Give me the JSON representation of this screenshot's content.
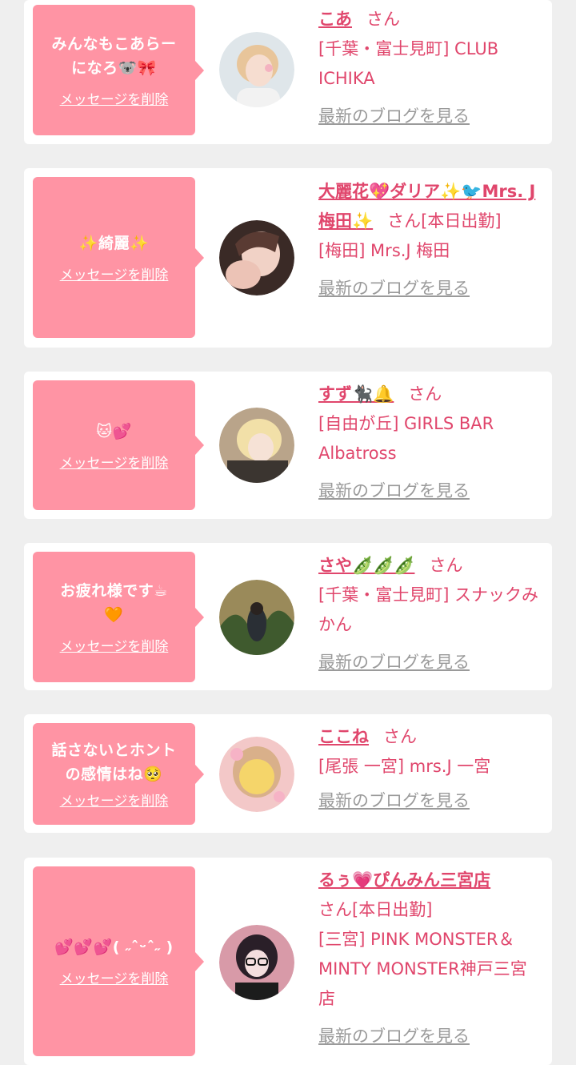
{
  "items": [
    {
      "message_lines": [
        "みんなもこあらー",
        "になろ🐨🎀"
      ],
      "delete_label": "メッセージを削除",
      "name": "こあ",
      "suffix": "さん",
      "shop": "[千葉・富士見町] CLUB ICHIKA",
      "blog_label": "最新のブログを見る"
    },
    {
      "message_lines": [
        "✨綺麗✨"
      ],
      "delete_label": "メッセージを削除",
      "name": "大麗花💖ダリア✨🐦Mrs. J 梅田✨",
      "suffix": "さん[本日出勤]",
      "shop": "[梅田] Mrs.J 梅田",
      "blog_label": "最新のブログを見る"
    },
    {
      "message_lines": [
        "🐱💕"
      ],
      "delete_label": "メッセージを削除",
      "name": "すず🐈‍⬛🔔",
      "suffix": "さん",
      "shop": "[自由が丘] GIRLS BAR Albatross",
      "blog_label": "最新のブログを見る"
    },
    {
      "message_lines": [
        "お疲れ様です☕",
        "🧡"
      ],
      "delete_label": "メッセージを削除",
      "name": "さや🫛🫛🫛",
      "suffix": "さん",
      "shop": "[千葉・富士見町] スナックみかん",
      "blog_label": "最新のブログを見る"
    },
    {
      "message_lines": [
        "話さないとホント",
        "の感情はね🥺"
      ],
      "delete_label": "メッセージを削除",
      "name": "ここね",
      "suffix": "さん",
      "shop": "[尾張 一宮] mrs.J 一宮",
      "blog_label": "最新のブログを見る"
    },
    {
      "message_lines": [
        "💕💕💕( ˶ˆᵕˆ˶ )"
      ],
      "delete_label": "メッセージを削除",
      "name": "るぅ💗ぴんみん三宮店",
      "suffix": "さん[本日出勤]",
      "shop": "[三宮] PINK MONSTER＆MINTY MONSTER神戸三宮店",
      "blog_label": "最新のブログを見る"
    }
  ],
  "colors": {
    "accent_pink": "#ff94a4",
    "name_pink": "#e0466c",
    "link_gray": "#9a9a9a",
    "background": "#efefef"
  }
}
